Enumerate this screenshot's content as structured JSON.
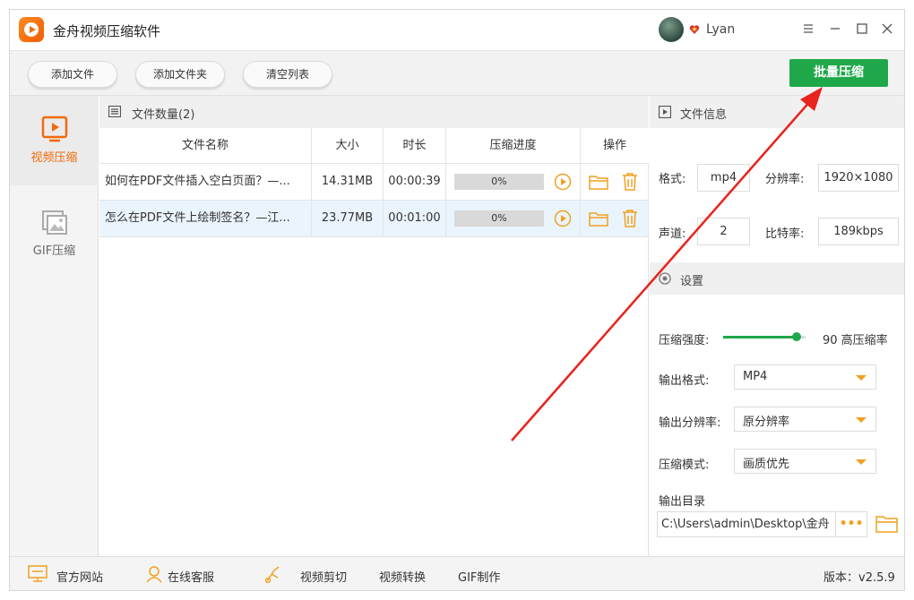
{
  "app": {
    "title": "金舟视频压缩软件",
    "username": "Lyan"
  },
  "toolbar": {
    "add_file": "添加文件",
    "add_folder": "添加文件夹",
    "clear_list": "清空列表",
    "batch_compress": "批量压缩"
  },
  "nav": {
    "video_compress": "视频压缩",
    "gif_compress": "GIF压缩"
  },
  "files": {
    "count_label": "文件数量(2)",
    "columns": [
      "文件名称",
      "大小",
      "时长",
      "压缩进度",
      "操作"
    ],
    "rows": [
      {
        "name": "如何在PDF文件插入空白页面？—...",
        "size": "14.31MB",
        "duration": "00:00:39",
        "progress": "0%"
      },
      {
        "name": "怎么在PDF文件上绘制签名？—江...",
        "size": "23.77MB",
        "duration": "00:01:00",
        "progress": "0%"
      }
    ]
  },
  "file_info": {
    "title": "文件信息",
    "format_label": "格式:",
    "format_value": "mp4",
    "resolution_label": "分辨率:",
    "resolution_value": "1920×1080",
    "channel_label": "声道:",
    "channel_value": "2",
    "bitrate_label": "比特率:",
    "bitrate_value": "189kbps"
  },
  "settings": {
    "title": "设置",
    "strength_label": "压缩强度:",
    "strength_value": 90,
    "strength_text": "90 高压缩率",
    "output_format_label": "输出格式:",
    "output_format_value": "MP4",
    "output_resolution_label": "输出分辨率:",
    "output_resolution_value": "原分辨率",
    "compress_mode_label": "压缩模式:",
    "compress_mode_value": "画质优先",
    "output_dir_label": "输出目录",
    "output_dir_value": "C:\\Users\\admin\\Desktop\\金舟",
    "more_label": "•••"
  },
  "footer": {
    "website": "官方网站",
    "support": "在线客服",
    "video_cut": "视频剪切",
    "video_convert": "视频转换",
    "gif_make": "GIF制作",
    "version": "版本：v2.5.9"
  },
  "colors": {
    "accent": "#f26a0b",
    "primary_green": "#1fa84a",
    "annotation": "#e8231d"
  }
}
